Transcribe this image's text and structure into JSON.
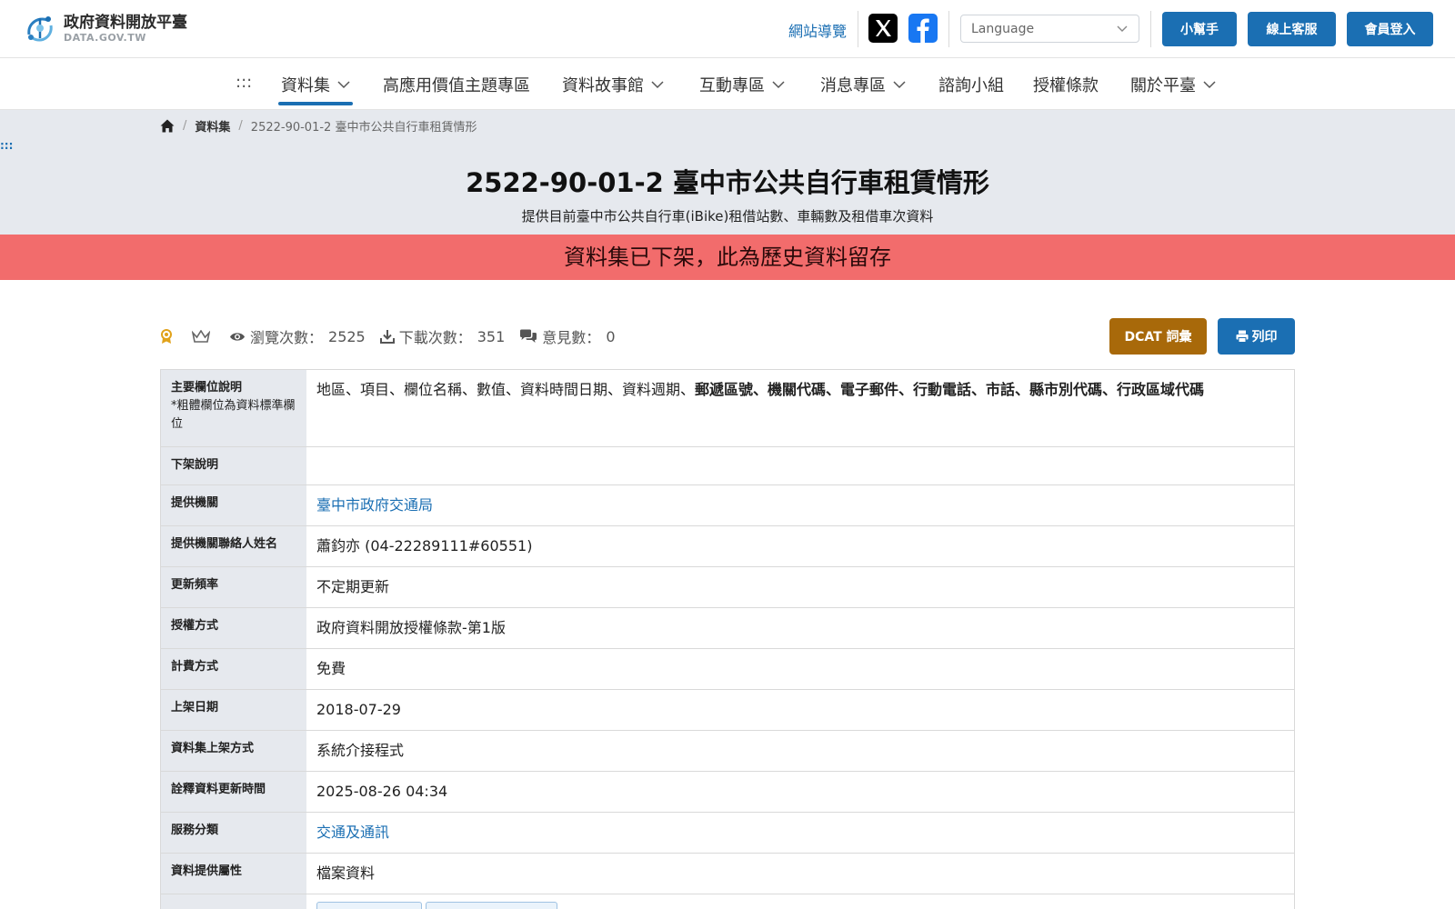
{
  "header": {
    "logo_title": "政府資料開放平臺",
    "logo_sub": "DATA.GOV.TW",
    "sitemap_label": "網站導覽",
    "language_placeholder": "Language",
    "helper_label": "小幫手",
    "support_label": "線上客服",
    "login_label": "會員登入"
  },
  "nav": {
    "skip_marker": ":::",
    "items": [
      {
        "label": "資料集"
      },
      {
        "label": "高應用價值主題專區"
      },
      {
        "label": "資料故事館"
      },
      {
        "label": "互動專區"
      },
      {
        "label": "消息專區"
      },
      {
        "label": "諮詢小組"
      },
      {
        "label": "授權條款"
      },
      {
        "label": "關於平臺"
      }
    ]
  },
  "breadcrumb": {
    "level1": "資料集",
    "current": "2522-90-01-2 臺中市公共自行車租賃情形"
  },
  "skip_marker_2": ":::",
  "page": {
    "title": "2522-90-01-2 臺中市公共自行車租賃情形",
    "subtitle": "提供目前臺中市公共自行車(iBike)租借站數、車輛數及租借車次資料",
    "banner": "資料集已下架，此為歷史資料留存"
  },
  "stats": {
    "views_label": "瀏覽次數：",
    "views_value": "2525",
    "downloads_label": "下載次數：",
    "downloads_value": "351",
    "comments_label": "意見數：",
    "comments_value": "0"
  },
  "actions": {
    "dcat_label": "DCAT 詞彙",
    "print_label": "列印"
  },
  "table": {
    "main_fields_label": "主要欄位說明",
    "main_fields_note": "*粗體欄位為資料標準欄位",
    "main_fields_plain": "地區、項目、欄位名稱、數值、資料時間日期、資料週期、",
    "main_fields_bold": "郵遞區號、機關代碼、電子郵件、行動電話、市話、縣市別代碼、行政區域代碼",
    "rows": [
      {
        "label": "下架說明",
        "value": ""
      },
      {
        "label": "提供機關",
        "value": "臺中市政府交通局"
      },
      {
        "label": "提供機關聯絡人姓名",
        "value": "蕭鈞亦 (04-22289111#60551)"
      },
      {
        "label": "更新頻率",
        "value": "不定期更新"
      },
      {
        "label": "授權方式",
        "value": "政府資料開放授權條款-第1版"
      },
      {
        "label": "計費方式",
        "value": "免費"
      },
      {
        "label": "上架日期",
        "value": "2018-07-29"
      },
      {
        "label": "資料集上架方式",
        "value": "系統介接程式"
      },
      {
        "label": "詮釋資料更新時間",
        "value": "2025-08-26 04:34"
      },
      {
        "label": "服務分類",
        "value": "交通及通訊"
      },
      {
        "label": "資料提供屬性",
        "value": "檔案資料"
      }
    ]
  }
}
